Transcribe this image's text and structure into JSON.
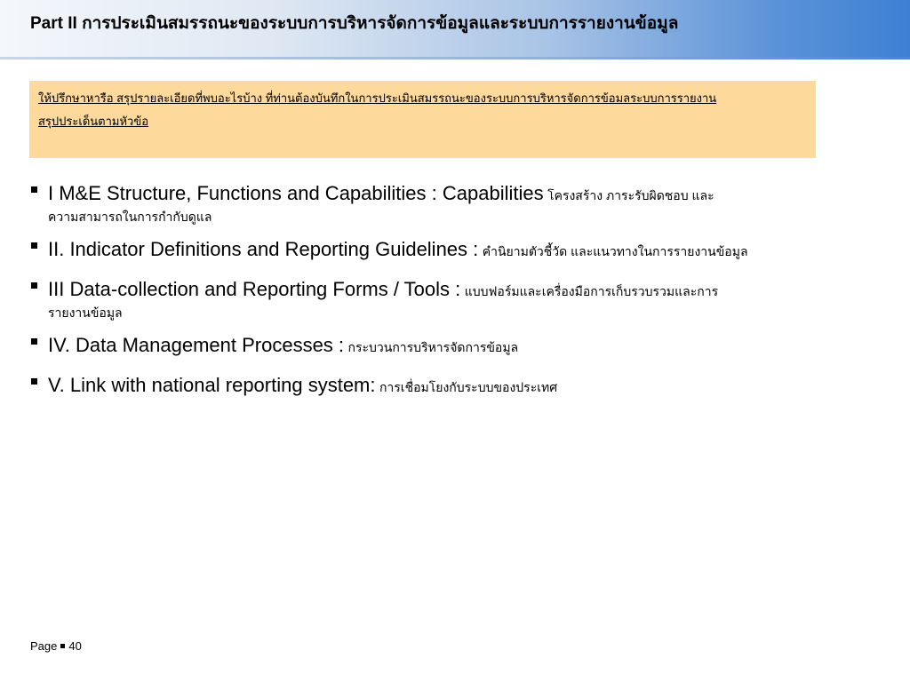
{
  "header": {
    "title": "Part II การประเมินสมรรถนะของระบบการบริหารจัดการข้อมูลและระบบการรายงานข้อมูล"
  },
  "notice": {
    "line1": "ให้ปรึกษาหารือ สรุปรายละเอียดที่พบอะไรบ้าง ที่ท่านต้องบันทึกในการประเมินสมรรถนะของระบบการบริหารจัดการข้อมลระบบการรายงาน",
    "line2": "สรุปประเด็นตามหัวข้อ"
  },
  "items": [
    {
      "en": "I M&E Structure, Functions and Capabilities : Capabilities",
      "th": "โครงสร้าง ภาระรับผิดชอบ และ",
      "cont": "ความสามารถในการกำกับดูแล"
    },
    {
      "en": "II. Indicator Definitions and Reporting Guidelines :",
      "th": "คำนิยามตัวชี้วัด และแนวทางในการรายงานข้อมูล",
      "cont": ""
    },
    {
      "en": "III Data-collection and Reporting Forms / Tools :",
      "th": "แบบฟอร์มและเครื่องมือการเก็บรวบรวมและการ",
      "cont": "รายงานข้อมูล"
    },
    {
      "en": "IV. Data Management Processes :",
      "th": "กระบวนการบริหารจัดการข้อมูล",
      "cont": ""
    },
    {
      "en": "V. Link with national reporting system:",
      "th": "การเชื่อมโยงกับระบบของประเทศ",
      "cont": ""
    }
  ],
  "footer": {
    "page_label": "Page",
    "page_number": "40"
  }
}
